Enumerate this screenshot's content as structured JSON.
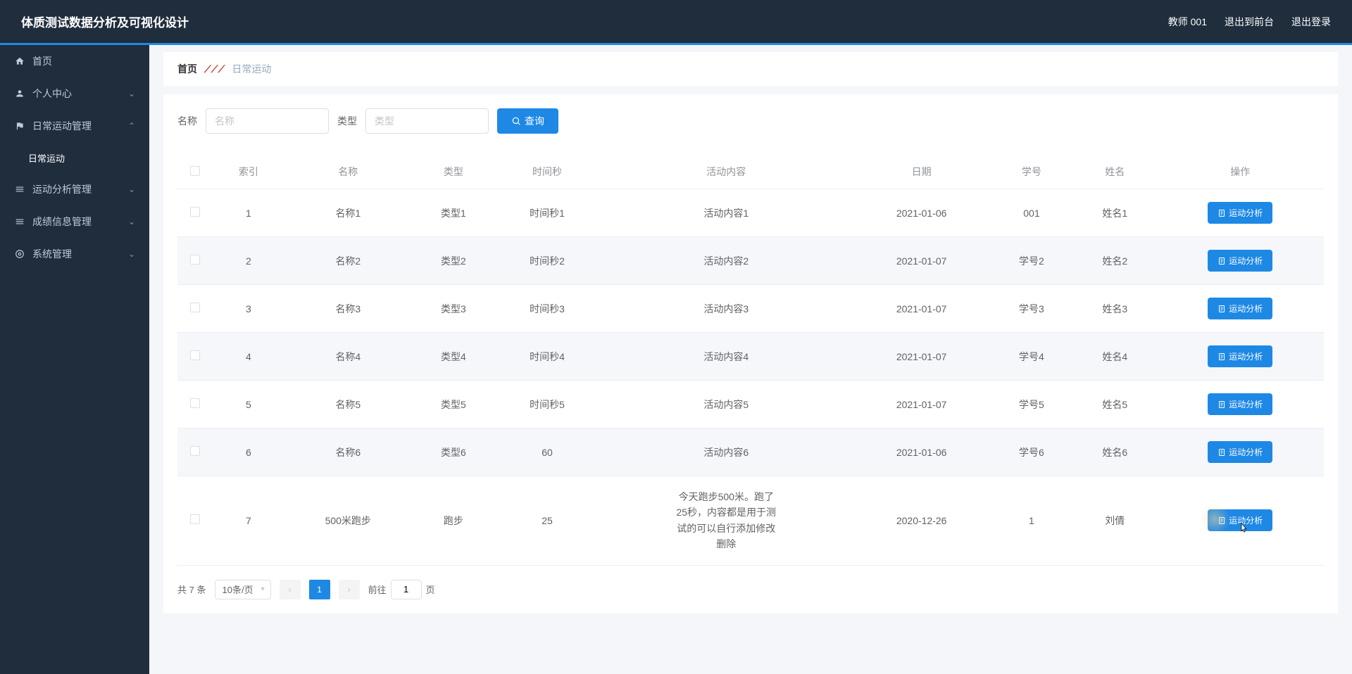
{
  "header": {
    "title": "体质测试数据分析及可视化设计",
    "user": "教师 001",
    "back_to_front": "退出到前台",
    "logout": "退出登录"
  },
  "sidebar": {
    "items": [
      {
        "icon": "home",
        "label": "首页",
        "expandable": false
      },
      {
        "icon": "user",
        "label": "个人中心",
        "expandable": true,
        "expanded": false
      },
      {
        "icon": "flag",
        "label": "日常运动管理",
        "expandable": true,
        "expanded": true,
        "children": [
          {
            "label": "日常运动",
            "active": true
          }
        ]
      },
      {
        "icon": "settings",
        "label": "运动分析管理",
        "expandable": true,
        "expanded": false
      },
      {
        "icon": "settings",
        "label": "成绩信息管理",
        "expandable": true,
        "expanded": false
      },
      {
        "icon": "gear",
        "label": "系统管理",
        "expandable": true,
        "expanded": false
      }
    ]
  },
  "breadcrumb": {
    "home": "首页",
    "current": "日常运动"
  },
  "filter": {
    "name_label": "名称",
    "name_placeholder": "名称",
    "type_label": "类型",
    "type_placeholder": "类型",
    "search_label": "查询"
  },
  "table": {
    "headers": [
      "索引",
      "名称",
      "类型",
      "时间秒",
      "活动内容",
      "日期",
      "学号",
      "姓名",
      "操作"
    ],
    "action_label": "运动分析",
    "rows": [
      {
        "index": "1",
        "name": "名称1",
        "type": "类型1",
        "time": "时间秒1",
        "content": "活动内容1",
        "date": "2021-01-06",
        "sno": "001",
        "sname": "姓名1"
      },
      {
        "index": "2",
        "name": "名称2",
        "type": "类型2",
        "time": "时间秒2",
        "content": "活动内容2",
        "date": "2021-01-07",
        "sno": "学号2",
        "sname": "姓名2"
      },
      {
        "index": "3",
        "name": "名称3",
        "type": "类型3",
        "time": "时间秒3",
        "content": "活动内容3",
        "date": "2021-01-07",
        "sno": "学号3",
        "sname": "姓名3"
      },
      {
        "index": "4",
        "name": "名称4",
        "type": "类型4",
        "time": "时间秒4",
        "content": "活动内容4",
        "date": "2021-01-07",
        "sno": "学号4",
        "sname": "姓名4"
      },
      {
        "index": "5",
        "name": "名称5",
        "type": "类型5",
        "time": "时间秒5",
        "content": "活动内容5",
        "date": "2021-01-07",
        "sno": "学号5",
        "sname": "姓名5"
      },
      {
        "index": "6",
        "name": "名称6",
        "type": "类型6",
        "time": "60",
        "content": "活动内容6",
        "date": "2021-01-06",
        "sno": "学号6",
        "sname": "姓名6"
      },
      {
        "index": "7",
        "name": "500米跑步",
        "type": "跑步",
        "time": "25",
        "content": "今天跑步500米。跑了25秒，内容都是用于测试的可以自行添加修改删除",
        "date": "2020-12-26",
        "sno": "1",
        "sname": "刘倩"
      }
    ]
  },
  "pagination": {
    "total_prefix": "共",
    "total_count": "7",
    "total_suffix": "条",
    "page_size": "10条/页",
    "current_page": "1",
    "goto_prefix": "前往",
    "goto_value": "1",
    "goto_suffix": "页"
  }
}
